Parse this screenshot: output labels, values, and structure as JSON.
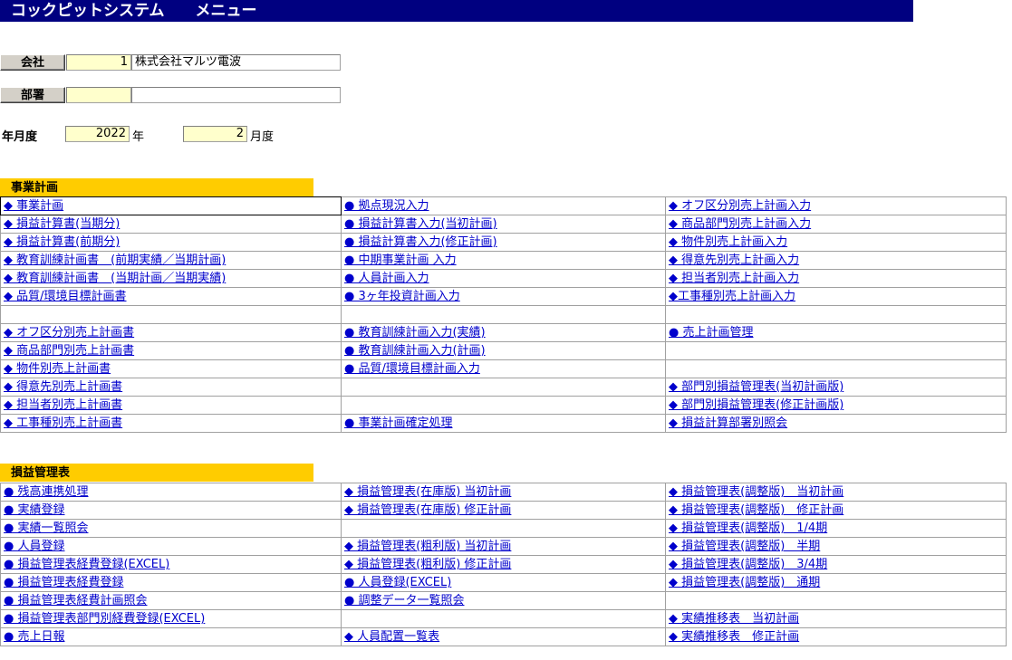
{
  "title": "コックピットシステム　　メニュー",
  "form": {
    "company_label": "会社",
    "company_code": "1",
    "company_name": "株式会社マルツ電波",
    "dept_label": "部署",
    "dept_code": "",
    "dept_name": "",
    "ym_label": "年月度",
    "year": "2022",
    "year_suffix": "年",
    "month": "2",
    "month_suffix": "月度"
  },
  "sections": [
    {
      "header": "事業計画",
      "rows": [
        [
          "◆ 事業計画",
          "● 拠点現況入力",
          "◆ オフ区分別売上計画入力"
        ],
        [
          "◆ 損益計算書(当期分)",
          "● 損益計算書入力(当初計画)",
          "◆ 商品部門別売上計画入力"
        ],
        [
          "◆ 損益計算書(前期分)",
          "● 損益計算書入力(修正計画)",
          "◆ 物件別売上計画入力"
        ],
        [
          "◆ 教育訓練計画書　(前期実績／当期計画)",
          "● 中期事業計画 入力",
          "◆ 得意先別売上計画入力"
        ],
        [
          "◆ 教育訓練計画書　(当期計画／当期実績)",
          "● 人員計画入力",
          "◆ 担当者別売上計画入力"
        ],
        [
          "◆ 品質/環境目標計画書",
          "● 3ヶ年投資計画入力",
          "◆工事種別売上計画入力"
        ],
        [
          "",
          "",
          ""
        ],
        [
          "◆ オフ区分別売上計画書",
          "● 教育訓練計画入力(実績)",
          "● 売上計画管理"
        ],
        [
          "◆ 商品部門別売上計画書",
          "● 教育訓練計画入力(計画)",
          ""
        ],
        [
          "◆ 物件別売上計画書",
          "● 品質/環境目標計画入力",
          ""
        ],
        [
          "◆ 得意先別売上計画書",
          "",
          "◆ 部門別損益管理表(当初計画版)"
        ],
        [
          "◆ 担当者別売上計画書",
          "",
          "◆ 部門別損益管理表(修正計画版)"
        ],
        [
          "◆ 工事種別売上計画書",
          "● 事業計画確定処理",
          "◆ 損益計算部署別照会"
        ]
      ]
    },
    {
      "header": "損益管理表",
      "rows": [
        [
          "● 残高連携処理",
          "◆ 損益管理表(在庫版) 当初計画",
          "◆ 損益管理表(調整版)　当初計画"
        ],
        [
          "● 実績登録",
          "◆ 損益管理表(在庫版) 修正計画",
          "◆ 損益管理表(調整版)　修正計画"
        ],
        [
          "● 実績一覧照会",
          "",
          "◆ 損益管理表(調整版)　1/4期"
        ],
        [
          "● 人員登録",
          "◆ 損益管理表(粗利版) 当初計画",
          "◆ 損益管理表(調整版)　半期"
        ],
        [
          "● 損益管理表経費登録(EXCEL)",
          "◆ 損益管理表(粗利版) 修正計画",
          "◆ 損益管理表(調整版)　3/4期"
        ],
        [
          "● 損益管理表経費登録",
          "● 人員登録(EXCEL)",
          "◆ 損益管理表(調整版)　通期"
        ],
        [
          "● 損益管理表経費計画照会",
          "● 調整データ一覧照会",
          ""
        ],
        [
          "● 損益管理表部門別経費登録(EXCEL)",
          "",
          "◆ 実績推移表　当初計画"
        ],
        [
          "● 売上日報",
          "◆ 人員配置一覧表",
          "◆ 実績推移表　修正計画"
        ]
      ]
    }
  ]
}
